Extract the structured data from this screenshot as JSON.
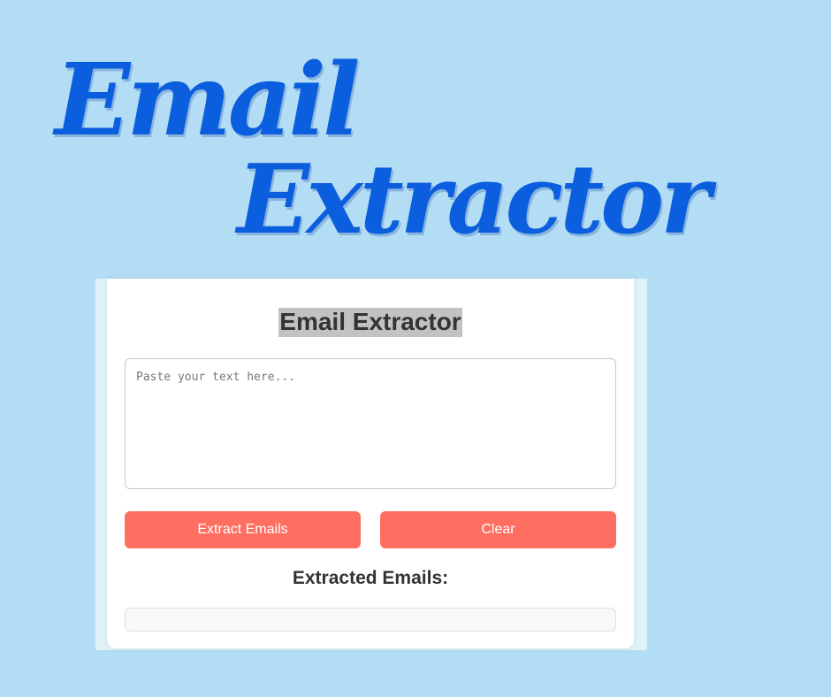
{
  "banner": {
    "line1": "Email",
    "line2": "Extractor"
  },
  "app": {
    "title": "Email Extractor",
    "input": {
      "value": "",
      "placeholder": "Paste your text here..."
    },
    "buttons": {
      "extract_label": "Extract Emails",
      "clear_label": "Clear"
    },
    "results": {
      "heading": "Extracted Emails:",
      "content": ""
    }
  },
  "colors": {
    "background": "#b3dcf5",
    "banner_text": "#0b5ede",
    "button": "#ff6f61",
    "card": "#ffffff"
  }
}
